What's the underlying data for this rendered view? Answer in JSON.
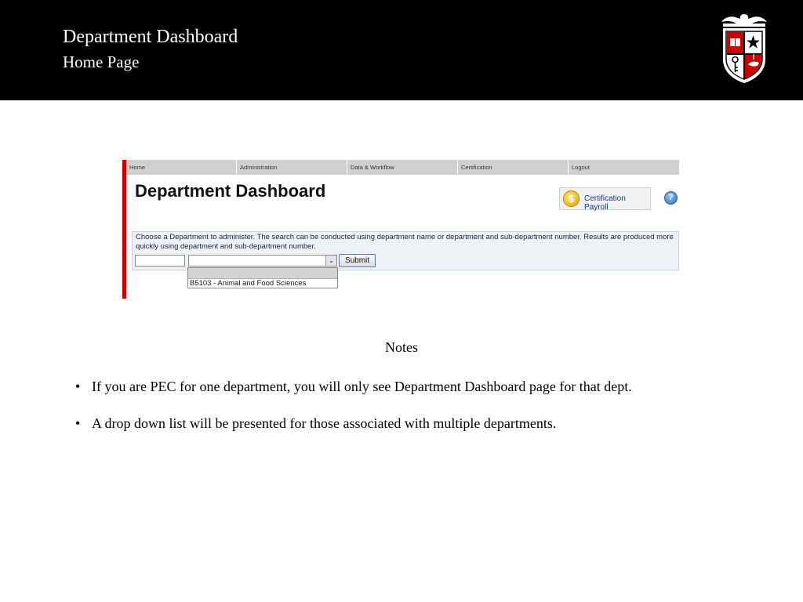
{
  "slide": {
    "title": "Department Dashboard",
    "subtitle": "Home Page"
  },
  "screenshot": {
    "nav": [
      {
        "label": "Home"
      },
      {
        "label": "Administration"
      },
      {
        "label": "Data & Workflow"
      },
      {
        "label": "Certification"
      },
      {
        "label": "Logout"
      }
    ],
    "page_title": "Department Dashboard",
    "certification_button": {
      "icon_glyph": "$",
      "label": "Certification Payroll"
    },
    "help_icon_glyph": "?",
    "instructions": "Choose a Department to administer. The search can be conducted using department name or department and sub-department number. Results are produced more quickly using department and sub-department number.",
    "search_input": {
      "value": ""
    },
    "dept_select": {
      "value": "",
      "arrow_glyph": "⌄"
    },
    "submit_label": "Submit",
    "dropdown_options": [
      {
        "label": ""
      },
      {
        "label": "B5103 - Animal and Food Sciences"
      }
    ]
  },
  "notes": {
    "heading": "Notes",
    "bullets": [
      {
        "marker": "•",
        "text": "If you are PEC for one department, you will only see Department Dashboard page for that dept."
      },
      {
        "marker": "•",
        "text": "A drop down list will be presented for those associated with multiple departments."
      }
    ]
  },
  "colors": {
    "header_background": "#000000",
    "accent_red": "#cc0000",
    "nav_background": "#d0d0d0",
    "search_box_background": "#eef1f6"
  }
}
